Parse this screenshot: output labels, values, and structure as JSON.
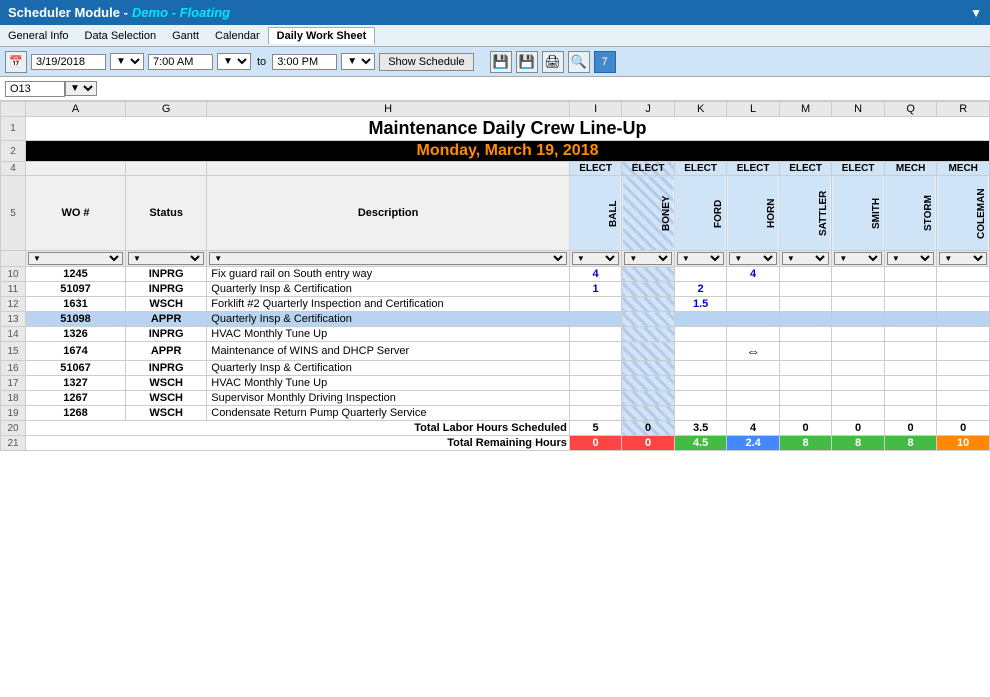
{
  "titleBar": {
    "moduleTitle": "Scheduler Module - ",
    "demoTitle": "Demo - Floating",
    "dropdownArrow": "▼"
  },
  "menuBar": {
    "items": [
      {
        "label": "General Info",
        "active": false
      },
      {
        "label": "Data Selection",
        "active": false
      },
      {
        "label": "Gantt",
        "active": false
      },
      {
        "label": "Calendar",
        "active": false
      },
      {
        "label": "Daily Work Sheet",
        "active": true
      }
    ]
  },
  "toolbar": {
    "calendarIcon": "📅",
    "date": "3/19/2018",
    "timeFrom": "7:00 AM",
    "toLabel": "to",
    "timeTo": "3:00 PM",
    "showScheduleLabel": "Show Schedule",
    "icons": [
      "💾",
      "💾",
      "🖨",
      "🔍",
      "7"
    ]
  },
  "cellRef": {
    "value": "O13"
  },
  "spreadsheet": {
    "title": "Maintenance Daily Crew Line-Up",
    "dateDisplay": "Monday, March 19, 2018",
    "columnHeaders": [
      "A",
      "G",
      "H",
      "I",
      "J",
      "K",
      "L",
      "M",
      "N",
      "Q",
      "R"
    ],
    "crewTypeRow": {
      "I": "ELECT",
      "J": "ELECT",
      "K": "ELECT",
      "L": "ELECT",
      "M": "ELECT",
      "N": "ELECT",
      "Q": "MECH",
      "R": "MECH"
    },
    "crewNameRow": {
      "woh": "WO #",
      "status": "Status",
      "description": "Description",
      "I": "BALL",
      "J": "BONEY",
      "K": "FORD",
      "L": "HORN",
      "M": "SATTLER",
      "N": "SMITH",
      "Q": "STORM",
      "R": "COLEMAN"
    },
    "rows": [
      {
        "rowNum": 10,
        "wo": "1245",
        "status": "INPRG",
        "desc": "Fix guard rail on South entry way",
        "I": "4",
        "J": "",
        "K": "",
        "L": "4",
        "M": "",
        "N": "",
        "Q": "",
        "R": "",
        "selected": false
      },
      {
        "rowNum": 11,
        "wo": "51097",
        "status": "INPRG",
        "desc": "Quarterly Insp & Certification",
        "I": "1",
        "J": "",
        "K": "2",
        "L": "",
        "M": "",
        "N": "",
        "Q": "",
        "R": "",
        "selected": false
      },
      {
        "rowNum": 12,
        "wo": "1631",
        "status": "WSCH",
        "desc": "Forklift #2 Quarterly Inspection and Certification",
        "I": "",
        "J": "",
        "K": "1.5",
        "L": "",
        "M": "",
        "N": "",
        "Q": "",
        "R": "",
        "selected": false
      },
      {
        "rowNum": 13,
        "wo": "51098",
        "status": "APPR",
        "desc": "Quarterly Insp & Certification",
        "I": "",
        "J": "",
        "K": "",
        "L": "",
        "M": "",
        "N": "",
        "Q": "",
        "R": "",
        "selected": true
      },
      {
        "rowNum": 14,
        "wo": "1326",
        "status": "INPRG",
        "desc": "HVAC Monthly Tune Up",
        "I": "",
        "J": "",
        "K": "",
        "L": "",
        "M": "",
        "N": "",
        "Q": "",
        "R": "",
        "selected": false
      },
      {
        "rowNum": 15,
        "wo": "1674",
        "status": "APPR",
        "desc": "Maintenance of WINS and DHCP Server",
        "I": "",
        "J": "",
        "K": "",
        "L": "⇔",
        "M": "",
        "N": "",
        "Q": "",
        "R": "",
        "selected": false
      },
      {
        "rowNum": 16,
        "wo": "51067",
        "status": "INPRG",
        "desc": "Quarterly Insp & Certification",
        "I": "",
        "J": "",
        "K": "",
        "L": "",
        "M": "",
        "N": "",
        "Q": "",
        "R": "",
        "selected": false
      },
      {
        "rowNum": 17,
        "wo": "1327",
        "status": "WSCH",
        "desc": "HVAC Monthly Tune Up",
        "I": "",
        "J": "",
        "K": "",
        "L": "",
        "M": "",
        "N": "",
        "Q": "",
        "R": "",
        "selected": false
      },
      {
        "rowNum": 18,
        "wo": "1267",
        "status": "WSCH",
        "desc": "Supervisor Monthly Driving Inspection",
        "I": "",
        "J": "",
        "K": "",
        "L": "",
        "M": "",
        "N": "",
        "Q": "",
        "R": "",
        "selected": false
      },
      {
        "rowNum": 19,
        "wo": "1268",
        "status": "WSCH",
        "desc": "Condensate Return Pump Quarterly Service",
        "I": "",
        "J": "",
        "K": "",
        "L": "",
        "M": "",
        "N": "",
        "Q": "",
        "R": "",
        "selected": false
      }
    ],
    "totals": {
      "scheduledLabel": "Total Labor Hours Scheduled",
      "scheduledValues": {
        "I": "5",
        "J": "0",
        "K": "3.5",
        "L": "4",
        "M": "0",
        "N": "0",
        "Q": "0",
        "R": "0"
      },
      "remainingLabel": "Total Remaining Hours",
      "remainingValues": {
        "I": {
          "val": "0",
          "color": "red"
        },
        "J": {
          "val": "0",
          "color": "red"
        },
        "K": {
          "val": "4.5",
          "color": "green"
        },
        "L": {
          "val": "2.4",
          "color": "blue"
        },
        "M": {
          "val": "8",
          "color": "green"
        },
        "N": {
          "val": "8",
          "color": "green"
        },
        "Q": {
          "val": "8",
          "color": "green"
        },
        "R": {
          "val": "10",
          "color": "orange"
        }
      }
    }
  }
}
